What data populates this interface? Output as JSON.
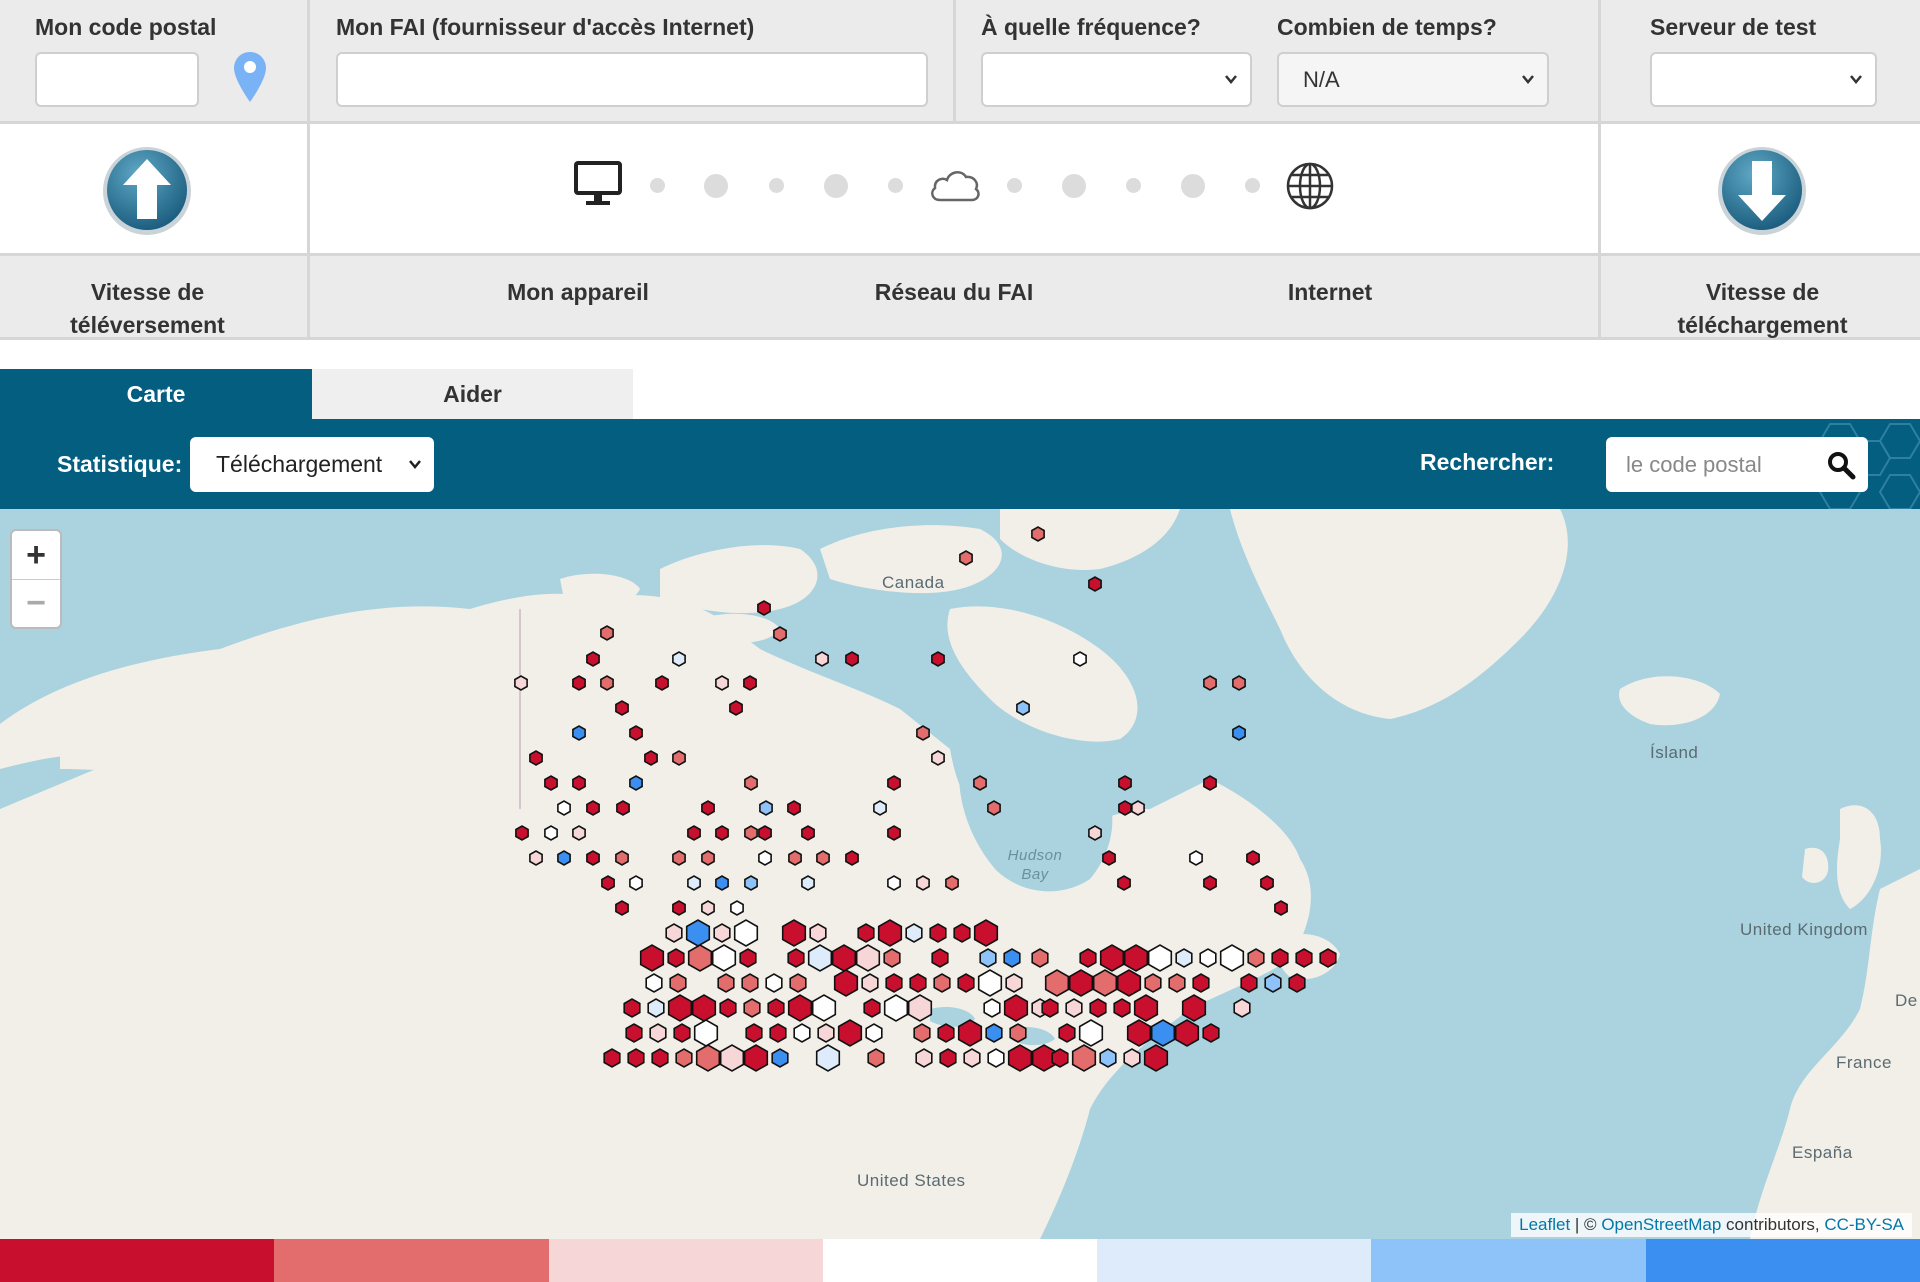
{
  "form": {
    "postal_label": "Mon code postal",
    "postal_value": "",
    "isp_label": "Mon FAI (fournisseur d'accès Internet)",
    "isp_value": "",
    "frequency_label": "À quelle fréquence?",
    "frequency_value": "",
    "duration_label": "Combien de temps?",
    "duration_value": "N/A",
    "server_label": "Serveur de test",
    "server_value": ""
  },
  "diagram": {
    "upload_label": "Vitesse de téléversement",
    "device_label": "Mon appareil",
    "isp_network_label": "Réseau du FAI",
    "internet_label": "Internet",
    "download_label": "Vitesse de téléchargement",
    "icons": [
      "monitor-icon",
      "cloud-icon",
      "globe-icon",
      "upload-arrow-icon",
      "download-arrow-icon"
    ]
  },
  "tabs": [
    {
      "label": "Carte",
      "active": true
    },
    {
      "label": "Aider",
      "active": false
    }
  ],
  "toolbar": {
    "statistic_label": "Statistique:",
    "statistic_value": "Téléchargement",
    "search_label": "Rechercher:",
    "search_placeholder": "le code postal"
  },
  "map": {
    "zoom_in": "+",
    "zoom_out": "−",
    "places": {
      "canada": "Canada",
      "hudson_bay": "Hudson Bay",
      "united_states": "United States",
      "island": "Ísland",
      "uk": "United Kingdom",
      "france": "France",
      "espana": "España",
      "de": "De"
    },
    "attribution": {
      "leaflet": "Leaflet",
      "sep": " | © ",
      "osm": "OpenStreetMap",
      "contributors": " contributors, ",
      "license": "CC-BY-SA"
    }
  },
  "colors": {
    "primary": "#035e80",
    "scale": [
      "#c8102e",
      "#e36c6c",
      "#f7d6d8",
      "#ffffff",
      "#deebfa",
      "#8ec3fa",
      "#3b8ff0"
    ]
  }
}
